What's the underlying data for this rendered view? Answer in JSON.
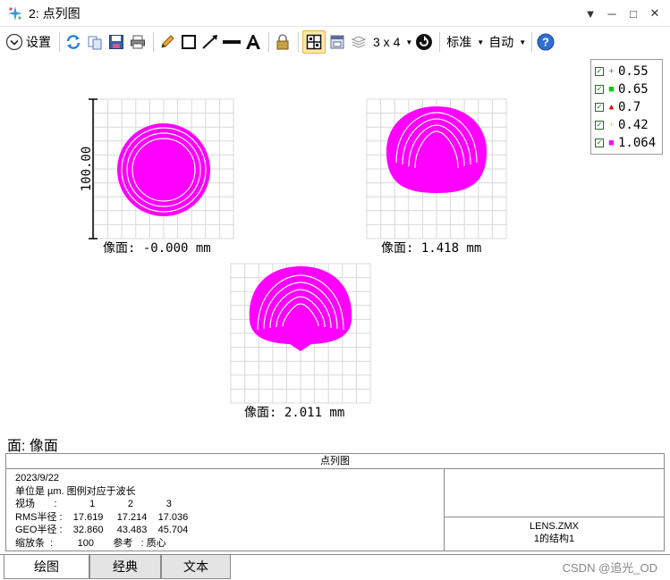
{
  "window": {
    "title": "2: 点列图",
    "controls": [
      "▼",
      "─",
      "□",
      "✕"
    ]
  },
  "toolbar": {
    "settings_label": "设置",
    "layout_label": "3 x 4",
    "standard_label": "标准",
    "auto_label": "自动"
  },
  "plot": {
    "scale_label": "100.00",
    "field_labels": [
      "像面: -0.000 mm",
      "像面: 1.418 mm",
      "像面: 2.011 mm"
    ],
    "spot_color": "#ff00ff",
    "surface_label": "面: 像面"
  },
  "legend": {
    "items": [
      {
        "value": "0.55",
        "marker": "+",
        "color": "#3b6fd1"
      },
      {
        "value": "0.65",
        "marker": "■",
        "color": "#00cc00"
      },
      {
        "value": "0.7",
        "marker": "▲",
        "color": "#dd0000"
      },
      {
        "value": "0.42",
        "marker": "+",
        "color": "#e8d060"
      },
      {
        "value": "1.064",
        "marker": "■",
        "color": "#ff00ff"
      }
    ]
  },
  "info": {
    "header": "点列图",
    "date": "2023/9/22",
    "units_line": "单位是 µm. 图例对应于波长",
    "field_row": "视场       :            1            2            3",
    "rms_row": "RMS半径 :    17.619     17.214    17.036",
    "geo_row": "GEO半径 :    32.860     43.483    45.704",
    "scale_row": "缩放条  :         100       参考   : 质心",
    "lens_file": "LENS.ZMX",
    "config": "1的结构1"
  },
  "tabs": [
    "绘图",
    "经典",
    "文本"
  ],
  "watermark": "CSDN @追光_OD"
}
